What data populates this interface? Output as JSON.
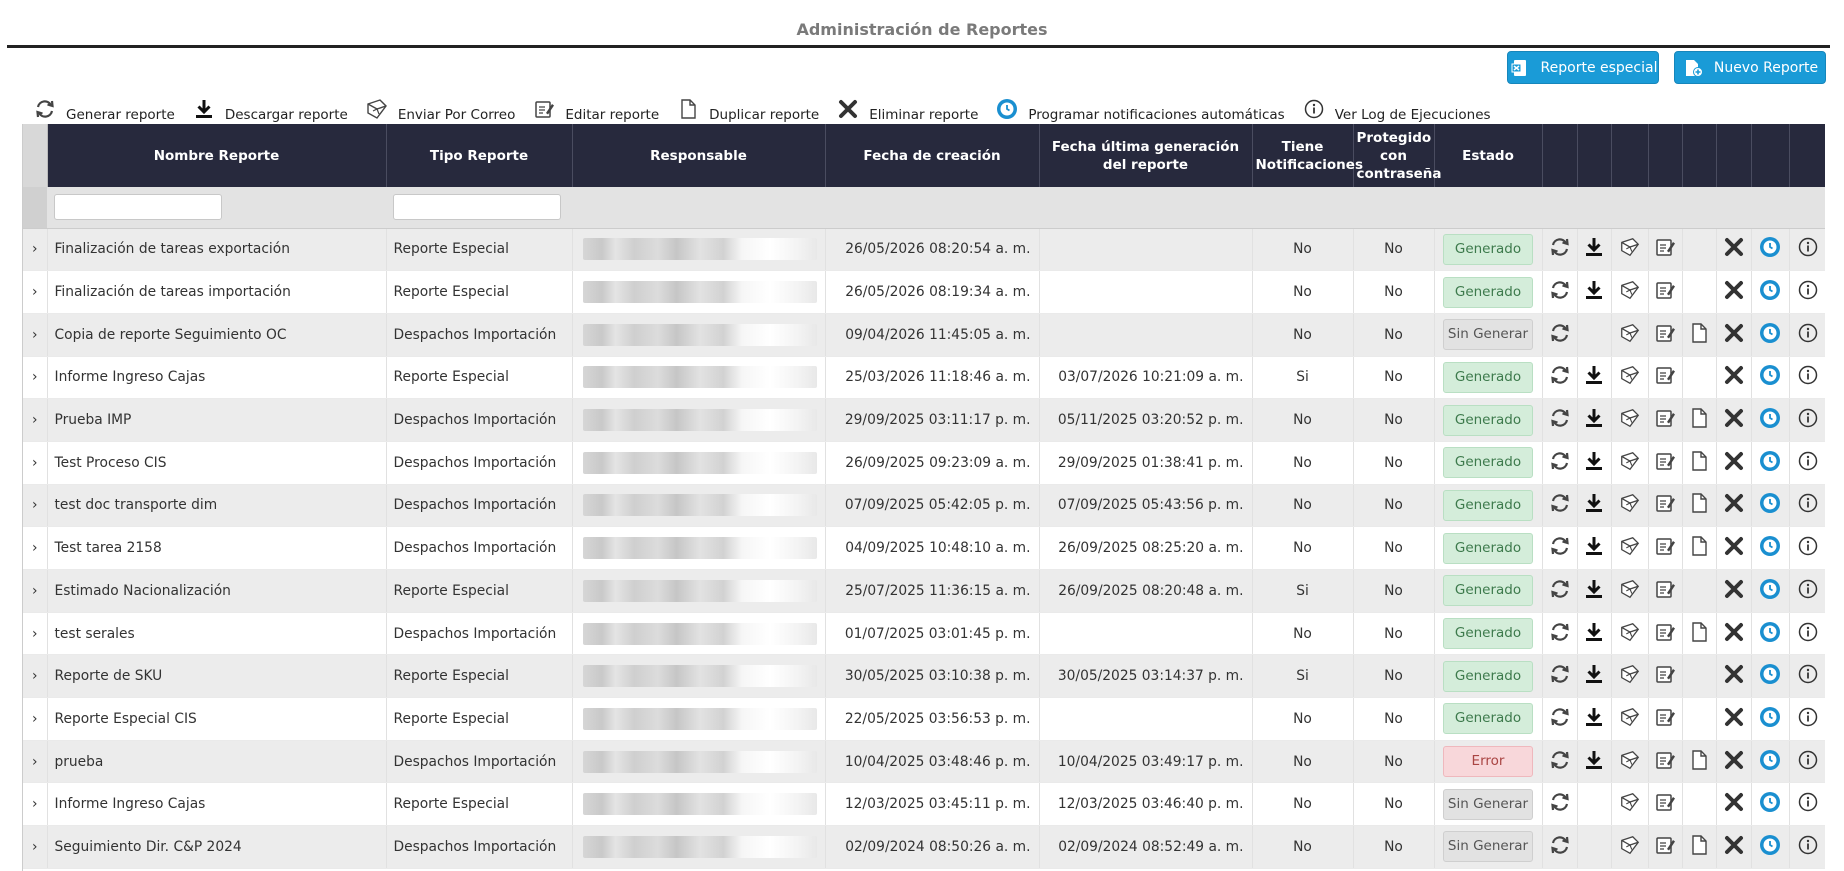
{
  "page": {
    "title": "Administración de Reportes"
  },
  "header_buttons": {
    "especial": {
      "label": "Reporte especial",
      "icon": "excel-doc-icon"
    },
    "nuevo": {
      "label": "Nuevo Reporte",
      "icon": "add-doc-icon"
    }
  },
  "toolbar": [
    {
      "label": "Generar reporte",
      "icon": "refresh-icon"
    },
    {
      "label": "Descargar reporte",
      "icon": "download-icon"
    },
    {
      "label": "Enviar Por Correo",
      "icon": "send-mail-icon"
    },
    {
      "label": "Editar reporte",
      "icon": "edit-doc-icon"
    },
    {
      "label": "Duplicar reporte",
      "icon": "duplicate-icon"
    },
    {
      "label": "Eliminar reporte",
      "icon": "delete-icon"
    },
    {
      "label": "Programar notificaciones automáticas",
      "icon": "clock-icon"
    },
    {
      "label": "Ver Log de Ejecuciones",
      "icon": "info-icon"
    }
  ],
  "columns": {
    "nombre": "Nombre Reporte",
    "tipo": "Tipo Reporte",
    "responsable": "Responsable",
    "fecha_creacion": "Fecha de creación",
    "fecha_ultima": "Fecha última generación del reporte",
    "notificaciones": "Tiene Notificaciones",
    "protegido": "Protegido con contraseña",
    "estado": "Estado"
  },
  "expand_glyph": "›",
  "colors": {
    "header_bg": "#27293d",
    "accent": "#1a9bd7",
    "ok": "#d4edda",
    "error": "#f8d7da"
  },
  "rows": [
    {
      "nombre": "Finalización de tareas exportación",
      "tipo": "Reporte Especial",
      "fecha_creacion": "26/05/2026 08:20:54 a. m.",
      "fecha_ultima": "",
      "notificaciones": "No",
      "protegido": "No",
      "estado": "Generado",
      "estado_kind": "ok",
      "download": true,
      "duplicate": false
    },
    {
      "nombre": "Finalización de tareas importación",
      "tipo": "Reporte Especial",
      "fecha_creacion": "26/05/2026 08:19:34 a. m.",
      "fecha_ultima": "",
      "notificaciones": "No",
      "protegido": "No",
      "estado": "Generado",
      "estado_kind": "ok",
      "download": true,
      "duplicate": false
    },
    {
      "nombre": "Copia de reporte Seguimiento OC",
      "tipo": "Despachos Importación",
      "fecha_creacion": "09/04/2026 11:45:05 a. m.",
      "fecha_ultima": "",
      "notificaciones": "No",
      "protegido": "No",
      "estado": "Sin Generar",
      "estado_kind": "none",
      "download": false,
      "duplicate": true
    },
    {
      "nombre": "Informe Ingreso Cajas",
      "tipo": "Reporte Especial",
      "fecha_creacion": "25/03/2026 11:18:46 a. m.",
      "fecha_ultima": "03/07/2026 10:21:09 a. m.",
      "notificaciones": "Si",
      "protegido": "No",
      "estado": "Generado",
      "estado_kind": "ok",
      "download": true,
      "duplicate": false
    },
    {
      "nombre": "Prueba IMP",
      "tipo": "Despachos Importación",
      "fecha_creacion": "29/09/2025 03:11:17 p. m.",
      "fecha_ultima": "05/11/2025 03:20:52 p. m.",
      "notificaciones": "No",
      "protegido": "No",
      "estado": "Generado",
      "estado_kind": "ok",
      "download": true,
      "duplicate": true
    },
    {
      "nombre": "Test Proceso CIS",
      "tipo": "Despachos Importación",
      "fecha_creacion": "26/09/2025 09:23:09 a. m.",
      "fecha_ultima": "29/09/2025 01:38:41 p. m.",
      "notificaciones": "No",
      "protegido": "No",
      "estado": "Generado",
      "estado_kind": "ok",
      "download": true,
      "duplicate": true
    },
    {
      "nombre": "test doc transporte dim",
      "tipo": "Despachos Importación",
      "fecha_creacion": "07/09/2025 05:42:05 p. m.",
      "fecha_ultima": "07/09/2025 05:43:56 p. m.",
      "notificaciones": "No",
      "protegido": "No",
      "estado": "Generado",
      "estado_kind": "ok",
      "download": true,
      "duplicate": true
    },
    {
      "nombre": "Test tarea 2158",
      "tipo": "Despachos Importación",
      "fecha_creacion": "04/09/2025 10:48:10 a. m.",
      "fecha_ultima": "26/09/2025 08:25:20 a. m.",
      "notificaciones": "No",
      "protegido": "No",
      "estado": "Generado",
      "estado_kind": "ok",
      "download": true,
      "duplicate": true
    },
    {
      "nombre": "Estimado Nacionalización",
      "tipo": "Reporte Especial",
      "fecha_creacion": "25/07/2025 11:36:15 a. m.",
      "fecha_ultima": "26/09/2025 08:20:48 a. m.",
      "notificaciones": "Si",
      "protegido": "No",
      "estado": "Generado",
      "estado_kind": "ok",
      "download": true,
      "duplicate": false
    },
    {
      "nombre": "test serales",
      "tipo": "Despachos Importación",
      "fecha_creacion": "01/07/2025 03:01:45 p. m.",
      "fecha_ultima": "",
      "notificaciones": "No",
      "protegido": "No",
      "estado": "Generado",
      "estado_kind": "ok",
      "download": true,
      "duplicate": true
    },
    {
      "nombre": "Reporte de SKU",
      "tipo": "Reporte Especial",
      "fecha_creacion": "30/05/2025 03:10:38 p. m.",
      "fecha_ultima": "30/05/2025 03:14:37 p. m.",
      "notificaciones": "Si",
      "protegido": "No",
      "estado": "Generado",
      "estado_kind": "ok",
      "download": true,
      "duplicate": false
    },
    {
      "nombre": "Reporte Especial CIS",
      "tipo": "Reporte Especial",
      "fecha_creacion": "22/05/2025 03:56:53 p. m.",
      "fecha_ultima": "",
      "notificaciones": "No",
      "protegido": "No",
      "estado": "Generado",
      "estado_kind": "ok",
      "download": true,
      "duplicate": false
    },
    {
      "nombre": "prueba",
      "tipo": "Despachos Importación",
      "fecha_creacion": "10/04/2025 03:48:46 p. m.",
      "fecha_ultima": "10/04/2025 03:49:17 p. m.",
      "notificaciones": "No",
      "protegido": "No",
      "estado": "Error",
      "estado_kind": "err",
      "download": true,
      "duplicate": true
    },
    {
      "nombre": "Informe Ingreso Cajas",
      "tipo": "Reporte Especial",
      "fecha_creacion": "12/03/2025 03:45:11 p. m.",
      "fecha_ultima": "12/03/2025 03:46:40 p. m.",
      "notificaciones": "No",
      "protegido": "No",
      "estado": "Sin Generar",
      "estado_kind": "none",
      "download": false,
      "duplicate": false
    },
    {
      "nombre": "Seguimiento Dir. C&P 2024",
      "tipo": "Despachos Importación",
      "fecha_creacion": "02/09/2024 08:50:26 a. m.",
      "fecha_ultima": "02/09/2024 08:52:49 a. m.",
      "notificaciones": "No",
      "protegido": "No",
      "estado": "Sin Generar",
      "estado_kind": "none",
      "download": false,
      "duplicate": true
    }
  ]
}
